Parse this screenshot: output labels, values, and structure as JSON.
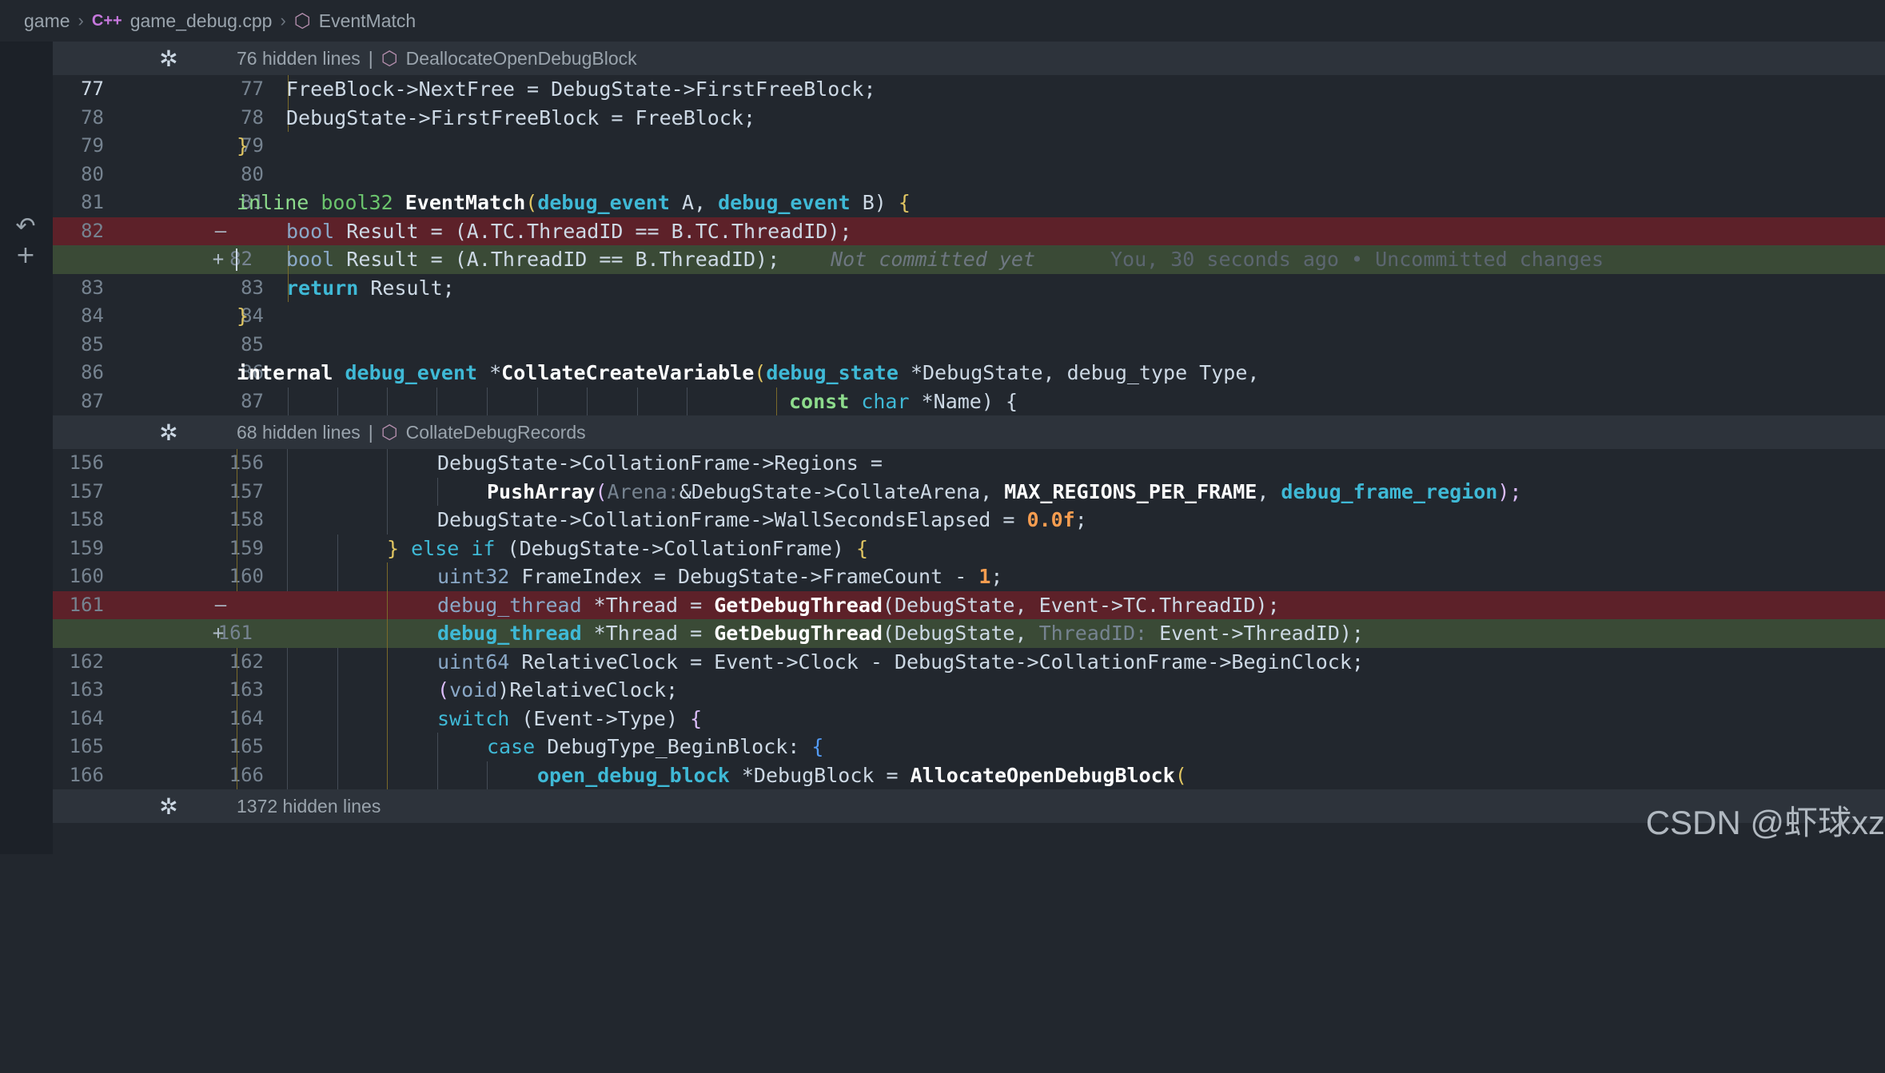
{
  "breadcrumb": {
    "root": "game",
    "file": "game_debug.cpp",
    "file_icon": "C++",
    "symbol": "EventMatch"
  },
  "folds": [
    {
      "hidden": "76 hidden lines",
      "sep": "|",
      "symbol": "DeallocateOpenDebugBlock"
    },
    {
      "hidden": "68 hidden lines",
      "sep": "|",
      "symbol": "CollateDebugRecords"
    },
    {
      "hidden": "1372 hidden lines"
    }
  ],
  "lines": {
    "l77": {
      "a": "77",
      "b": "77"
    },
    "l78": {
      "a": "78",
      "b": "78"
    },
    "l79": {
      "a": "79",
      "b": "79"
    },
    "l80": {
      "a": "80",
      "b": "80"
    },
    "l81": {
      "a": "81",
      "b": "81"
    },
    "l82r": {
      "a": "82",
      "mark": "—"
    },
    "l82a": {
      "b": "82",
      "mark": "+"
    },
    "l83": {
      "a": "83",
      "b": "83"
    },
    "l84": {
      "a": "84",
      "b": "84"
    },
    "l85": {
      "a": "85",
      "b": "85"
    },
    "l86": {
      "a": "86",
      "b": "86"
    },
    "l87": {
      "a": "87",
      "b": "87"
    },
    "l156": {
      "a": "156",
      "b": "156"
    },
    "l157": {
      "a": "157",
      "b": "157"
    },
    "l158": {
      "a": "158",
      "b": "158"
    },
    "l159": {
      "a": "159",
      "b": "159"
    },
    "l160": {
      "a": "160",
      "b": "160"
    },
    "l161r": {
      "a": "161",
      "mark": "—"
    },
    "l161a": {
      "b": "161",
      "mark": "+"
    },
    "l162": {
      "a": "162",
      "b": "162"
    },
    "l163": {
      "a": "163",
      "b": "163"
    },
    "l164": {
      "a": "164",
      "b": "164"
    },
    "l165": {
      "a": "165",
      "b": "165"
    },
    "l166": {
      "a": "166",
      "b": "166"
    }
  },
  "code": {
    "c77": "FreeBlock->NextFree = DebugState->FirstFreeBlock;",
    "c78": "DebugState->FirstFreeBlock = FreeBlock;",
    "c79": "}",
    "c81_kw": "inline",
    "c81_type": "bool32",
    "c81_fn": "EventMatch",
    "c81_p1": "(",
    "c81_t1": "debug_event",
    "c81_a": " A, ",
    "c81_t2": "debug_event",
    "c81_b": " B) ",
    "c81_brace": "{",
    "c82r_type": "bool",
    "c82r_rest": " Result = (A.TC.ThreadID == B.TC.ThreadID);",
    "c82a_type": "bool",
    "c82a_rest": " Result = (A.ThreadID == B.ThreadID);",
    "c82a_blame1": "Not committed yet",
    "c82a_blame2": "You, 30 seconds ago • Uncommitted changes",
    "c83_kw": "return",
    "c83_rest": " Result;",
    "c84": "}",
    "c86_kw": "internal",
    "c86_type": "debug_event",
    "c86_star": " *",
    "c86_fn": "CollateCreateVariable",
    "c86_p": "(",
    "c86_t2": "debug_state",
    "c86_rest": " *DebugState, debug_type Type,",
    "c87_kw": "const",
    "c87_type": "char",
    "c87_rest": " *Name) {",
    "c156": "DebugState->CollationFrame->Regions =",
    "c157_fn": "PushArray",
    "c157_p": "(",
    "c157_hint": "Arena:",
    "c157_mid": "&DebugState->CollateArena, ",
    "c157_macro": "MAX_REGIONS_PER_FRAME",
    "c157_comma": ", ",
    "c157_type": "debug_frame_region",
    "c157_end": ");",
    "c158_a": "DebugState->CollationFrame->WallSecondsElapsed = ",
    "c158_num": "0.0f",
    "c158_end": ";",
    "c159_brace": "} ",
    "c159_kw": "else if",
    "c159_rest": " (DebugState->CollationFrame) ",
    "c159_open": "{",
    "c160_type": "uint32",
    "c160_rest": " FrameIndex = DebugState->FrameCount - ",
    "c160_num": "1",
    "c160_end": ";",
    "c161r_type": "debug_thread",
    "c161r_a": " *Thread = ",
    "c161r_fn": "GetDebugThread",
    "c161r_rest": "(DebugState, Event->TC.ThreadID);",
    "c161a_type": "debug_thread",
    "c161a_a": " *Thread = ",
    "c161a_fn": "GetDebugThread",
    "c161a_p": "(DebugState, ",
    "c161a_hint": "ThreadID:",
    "c161a_rest": " Event->ThreadID);",
    "c162_type": "uint64",
    "c162_rest": " RelativeClock = Event->Clock - DebugState->CollationFrame->BeginClock;",
    "c163_p": "(",
    "c163_type": "void",
    "c163_rest": ")RelativeClock;",
    "c164_kw": "switch",
    "c164_rest": " (Event->Type) ",
    "c164_open": "{",
    "c165_kw": "case",
    "c165_rest": " DebugType_BeginBlock: ",
    "c165_open": "{",
    "c166_type": "open_debug_block",
    "c166_rest": " *DebugBlock = ",
    "c166_fn": "AllocateOpenDebugBlock",
    "c166_open": "("
  },
  "gutter_icons": {
    "revert": "undo-icon",
    "add": "plus-icon"
  },
  "watermark": "CSDN @虾球xz"
}
